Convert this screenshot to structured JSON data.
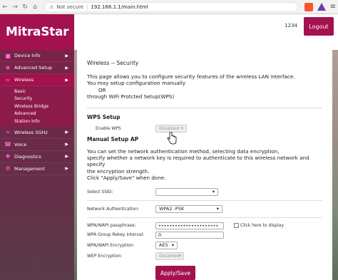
{
  "browser": {
    "back_icon": "back-arrow-icon",
    "forward_icon": "forward-arrow-icon",
    "reload_icon": "reload-icon",
    "home_icon": "home-icon",
    "security_label": "Not secure",
    "url": "192.168.1.1/main.html"
  },
  "header": {
    "logo": "MitraStar",
    "user_id": "1234",
    "logout_label": "Logout"
  },
  "sidebar": {
    "items": [
      {
        "label": "Device Info",
        "icon": "info-icon"
      },
      {
        "label": "Advanced Setup",
        "icon": "gears-icon"
      },
      {
        "label": "Wireless",
        "icon": "wifi-icon"
      },
      {
        "label": "Wireless 5GHz",
        "icon": "wifi-icon"
      },
      {
        "label": "Voice",
        "icon": "phone-icon"
      },
      {
        "label": "Diagnostics",
        "icon": "diagnostics-icon"
      },
      {
        "label": "Management",
        "icon": "tools-icon"
      }
    ],
    "wireless_sub": [
      "Basic",
      "Security",
      "Wireless Bridge",
      "Advanced",
      "Station Info"
    ]
  },
  "content": {
    "title": "Wireless -- Security",
    "intro_1": "This page allows you to configure security features of the wireless LAN interface.",
    "intro_2": "You may setup configuration manually",
    "intro_3": "OR",
    "intro_4": "through WiFi Protcted Setup(WPS)",
    "wps_heading": "WPS Setup",
    "enable_wps_label": "Enable WPS",
    "enable_wps_value": "Disabled",
    "manual_heading": "Manual Setup AP",
    "manual_1": "You can set the network authentication method, selecting data encryption,",
    "manual_2": "specify whether a network key is required to authenticate to this wireless network and specify",
    "manual_3": "the encryption strength.",
    "manual_4": "Click \"Apply/Save\" when done.",
    "ssid_label": "Select SSID:",
    "ssid_value": "",
    "auth_label": "Network Authentication:",
    "auth_value": "WPA2 -PSK",
    "pass_label": "WPA/WAPI passphrase:",
    "pass_value": "••••••••••••••••••••••",
    "display_label": "Click here to display",
    "rekey_label": "WPA Group Rekey Interval:",
    "rekey_value": "0",
    "enc_label": "WPA/WAPI Encryption:",
    "enc_value": "AES",
    "wep_label": "WEP Encryption:",
    "wep_value": "Disabled",
    "apply_label": "Apply/Save"
  },
  "colors": {
    "brand": "#a4114f",
    "sidebar": "#6b2a48"
  }
}
